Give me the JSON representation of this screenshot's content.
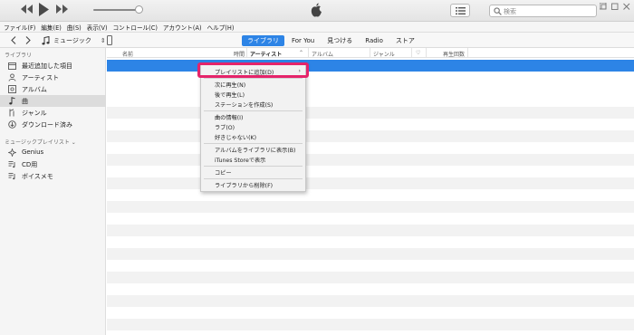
{
  "search": {
    "placeholder": "検索"
  },
  "menubar": [
    "ファイル(F)",
    "編集(E)",
    "曲(S)",
    "表示(V)",
    "コントロール(C)",
    "アカウント(A)",
    "ヘルプ(H)"
  ],
  "nav": {
    "source": "ミュージック",
    "tabs": [
      "ライブラリ",
      "For You",
      "見つける",
      "Radio",
      "ストア"
    ],
    "active_tab": 0
  },
  "sidebar": {
    "library_header": "ライブラリ",
    "library_items": [
      {
        "label": "最近追加した項目",
        "icon": "recently-added-icon"
      },
      {
        "label": "アーティスト",
        "icon": "artist-icon"
      },
      {
        "label": "アルバム",
        "icon": "album-icon"
      },
      {
        "label": "曲",
        "icon": "music-note-icon",
        "selected": true
      },
      {
        "label": "ジャンル",
        "icon": "genre-icon"
      },
      {
        "label": "ダウンロード済み",
        "icon": "downloaded-icon"
      }
    ],
    "playlists_header": "ミュージックプレイリスト ⌄",
    "playlist_items": [
      {
        "label": "Genius",
        "icon": "genius-icon"
      },
      {
        "label": "CD用",
        "icon": "playlist-icon"
      },
      {
        "label": "ボイスメモ",
        "icon": "playlist-icon"
      }
    ]
  },
  "columns": {
    "name": "名前",
    "time": "時間",
    "artist": "アーティスト",
    "album": "アルバム",
    "genre": "ジャンル",
    "heart": "♡",
    "plays": "再生回数"
  },
  "context_menu": {
    "groups": [
      [
        "プレイリストに追加(D)"
      ],
      [
        "次に再生(N)",
        "後で再生(L)",
        "ステーションを作成(S)"
      ],
      [
        "曲の情報(I)",
        "ラブ(O)",
        "好きじゃない(K)"
      ],
      [
        "アルバムをライブラリに表示(B)",
        "iTunes Storeで表示"
      ],
      [
        "コピー"
      ],
      [
        "ライブラリから削除(F)"
      ]
    ],
    "submenu_arrow": "›"
  },
  "colors": {
    "accent": "#2d84e6",
    "highlight": "#e5246a"
  }
}
